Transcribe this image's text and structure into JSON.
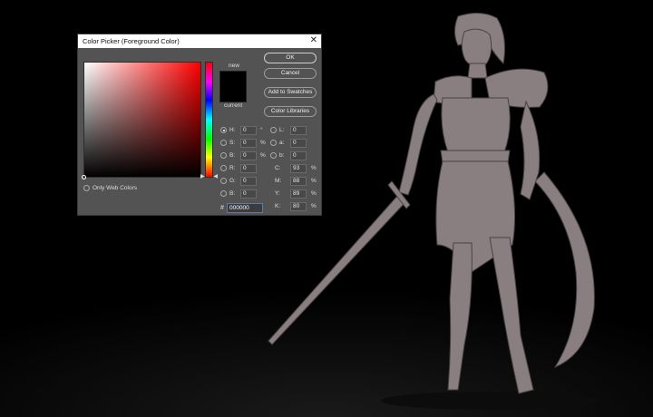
{
  "dialog": {
    "title": "Color Picker (Foreground Color)",
    "close_glyph": "✕",
    "new_label": "new",
    "current_label": "current",
    "new_color": "#000000",
    "current_color": "#000000",
    "only_web_colors_label": "Only Web Colors",
    "buttons": {
      "ok": "OK",
      "cancel": "Cancel",
      "add_to_swatches": "Add to Swatches",
      "color_libraries": "Color Libraries"
    },
    "hsb": {
      "h": {
        "label": "H:",
        "value": "0",
        "unit": "°"
      },
      "s": {
        "label": "S:",
        "value": "0",
        "unit": "%"
      },
      "b": {
        "label": "B:",
        "value": "0",
        "unit": "%"
      }
    },
    "rgb": {
      "r": {
        "label": "R:",
        "value": "0"
      },
      "g": {
        "label": "G:",
        "value": "0"
      },
      "b": {
        "label": "B:",
        "value": "0"
      }
    },
    "lab": {
      "l": {
        "label": "L:",
        "value": "0"
      },
      "a": {
        "label": "a:",
        "value": "0"
      },
      "b": {
        "label": "b:",
        "value": "0"
      }
    },
    "cmyk": {
      "c": {
        "label": "C:",
        "value": "93",
        "unit": "%"
      },
      "m": {
        "label": "M:",
        "value": "88",
        "unit": "%"
      },
      "y": {
        "label": "Y:",
        "value": "89",
        "unit": "%"
      },
      "k": {
        "label": "K:",
        "value": "80",
        "unit": "%"
      }
    },
    "hex": {
      "hash": "#",
      "value": "000000"
    },
    "selected_mode": "H"
  },
  "canvas": {
    "background_color": "#000000",
    "figure_color": "#8a7f80",
    "figure_outline_color": "#4a4244"
  }
}
